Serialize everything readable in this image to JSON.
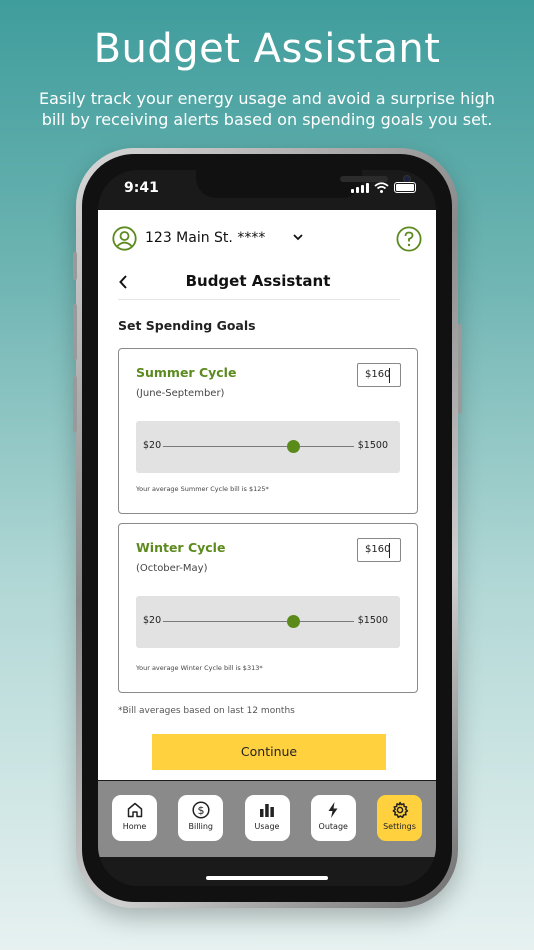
{
  "hero": {
    "title": "Budget Assistant",
    "subtitle": "Easily track your energy usage and avoid a surprise high bill by receiving alerts based on spending goals you set."
  },
  "status_bar": {
    "time": "9:41"
  },
  "account": {
    "address": "123 Main St. ****"
  },
  "nav": {
    "title": "Budget Assistant"
  },
  "section_title": "Set Spending Goals",
  "cards": [
    {
      "title": "Summer Cycle",
      "subtitle": "(June-September)",
      "amount": "$160",
      "slider_min": "$20",
      "slider_max": "$1500",
      "slider_fraction": 0.68,
      "note": "Your average Summer Cycle bill is $125*"
    },
    {
      "title": "Winter Cycle",
      "subtitle": "(October-May)",
      "amount": "$160",
      "slider_min": "$20",
      "slider_max": "$1500",
      "slider_fraction": 0.68,
      "note": "Your average Winter Cycle bill is $313*"
    }
  ],
  "footnote": "*Bill averages based on last 12 months",
  "continue_label": "Continue",
  "tabs": [
    {
      "label": "Home",
      "icon": "home-icon"
    },
    {
      "label": "Billing",
      "icon": "dollar-icon"
    },
    {
      "label": "Usage",
      "icon": "bar-chart-icon"
    },
    {
      "label": "Outage",
      "icon": "lightning-icon"
    },
    {
      "label": "Settings",
      "icon": "gear-icon",
      "active": true
    }
  ],
  "colors": {
    "accent_green": "#5c8a1e",
    "accent_yellow": "#ffd13f",
    "teal_background": "#3f9d9c"
  }
}
